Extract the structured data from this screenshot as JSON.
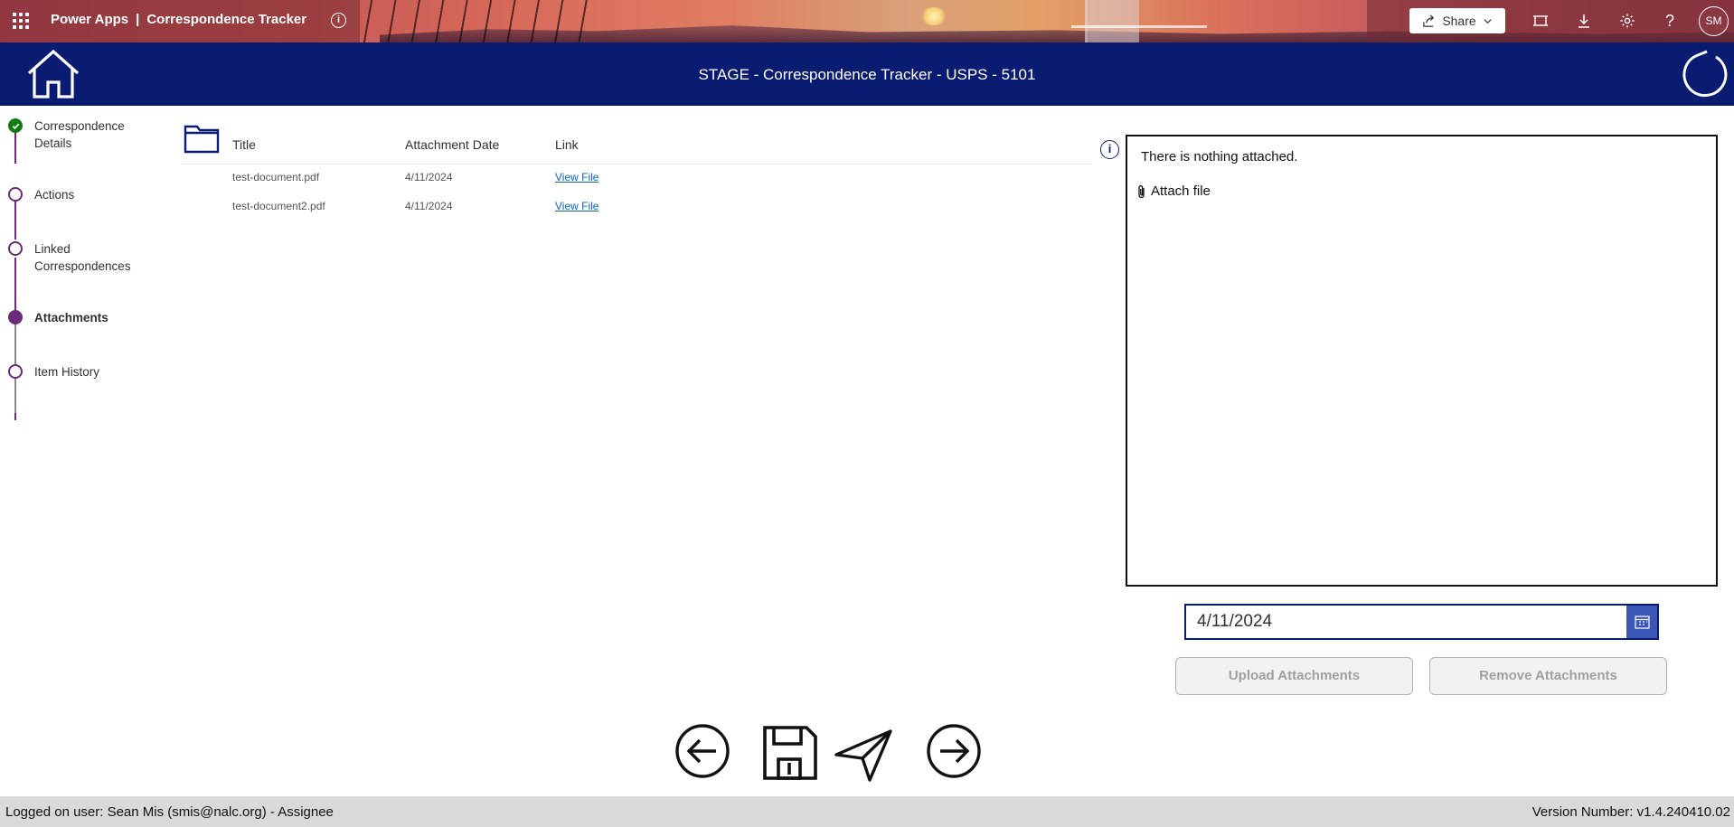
{
  "topbar": {
    "app_name": "Power Apps",
    "separator": "|",
    "app_title": "Correspondence Tracker",
    "share_label": "Share",
    "avatar_initials": "SM",
    "help_label": "?"
  },
  "header": {
    "title": "STAGE - Correspondence Tracker  - USPS - 5101",
    "color": "#0a1b72"
  },
  "steps": [
    {
      "label": "Correspondence Details",
      "state": "done"
    },
    {
      "label": "Actions",
      "state": "pending"
    },
    {
      "label": "Linked Correspondences",
      "state": "pending"
    },
    {
      "label": "Attachments",
      "state": "active"
    },
    {
      "label": "Item History",
      "state": "pending"
    }
  ],
  "table": {
    "headers": [
      "Title",
      "Attachment Date",
      "Link"
    ],
    "rows": [
      {
        "title": "test-document.pdf",
        "date": "4/11/2024",
        "link": "View File"
      },
      {
        "title": "test-document2.pdf",
        "date": "4/11/2024",
        "link": "View File"
      }
    ]
  },
  "attachments": {
    "empty_text": "There is nothing attached.",
    "attach_label": "Attach file",
    "info_label": "i"
  },
  "date_picker": {
    "value": "4/11/2024"
  },
  "buttons": {
    "upload": "Upload Attachments",
    "remove": "Remove Attachments"
  },
  "nav_icons": [
    "back-arrow-icon",
    "save-icon",
    "send-icon",
    "forward-arrow-icon"
  ],
  "footer": {
    "user": "Logged on user: Sean Mis (smis@nalc.org) - Assignee",
    "version": "Version Number: v1.4.240410.02"
  },
  "colors": {
    "accent_purple": "#6b2a7a",
    "done_green": "#107c10",
    "link_blue": "#0b63c4",
    "calendar_blue": "#3a57b8"
  }
}
